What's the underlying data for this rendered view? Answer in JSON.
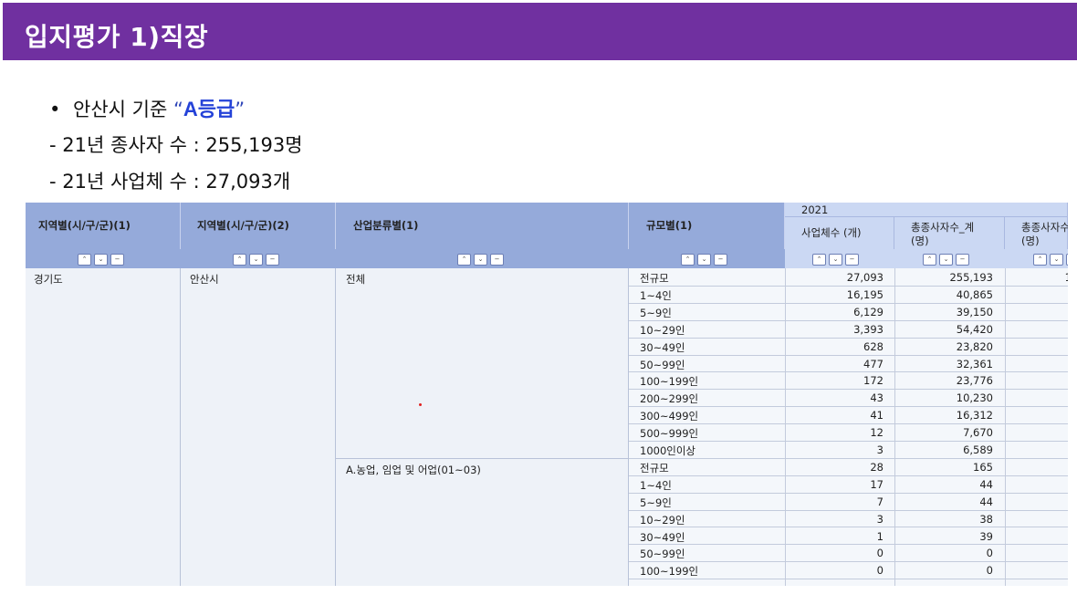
{
  "title": "입지평가 1)직장",
  "bullet": {
    "prefix": "안산시 기준 ",
    "quote_open": "“",
    "grade": "A등급",
    "quote_close": "”"
  },
  "stats": [
    "- 21년 종사자 수 : 255,193명",
    "- 21년 사업체 수 : 27,093개"
  ],
  "table": {
    "year": "2021",
    "headers": {
      "region1": "지역별(시/구/군)(1)",
      "region2": "지역별(시/구/군)(2)",
      "industry": "산업분류별(1)",
      "scale": "규모별(1)",
      "col_a": "사업체수 (개)",
      "col_b_1": "총종사자수_계",
      "col_b_2": "(명)",
      "col_c_1": "총종사자수",
      "col_c_2": "(명)"
    },
    "ctrl": {
      "up": "⌃",
      "down": "⌄",
      "minus": "−"
    },
    "region1": "경기도",
    "region2": "안산시",
    "industry_groups": [
      {
        "name": "전체",
        "rows": [
          {
            "scale": "전규모",
            "a": "27,093",
            "b": "255,193",
            "c": "1"
          },
          {
            "scale": "1~4인",
            "a": "16,195",
            "b": "40,865",
            "c": ""
          },
          {
            "scale": "5~9인",
            "a": "6,129",
            "b": "39,150",
            "c": ""
          },
          {
            "scale": "10~29인",
            "a": "3,393",
            "b": "54,420",
            "c": ""
          },
          {
            "scale": "30~49인",
            "a": "628",
            "b": "23,820",
            "c": ""
          },
          {
            "scale": "50~99인",
            "a": "477",
            "b": "32,361",
            "c": ""
          },
          {
            "scale": "100~199인",
            "a": "172",
            "b": "23,776",
            "c": ""
          },
          {
            "scale": "200~299인",
            "a": "43",
            "b": "10,230",
            "c": ""
          },
          {
            "scale": "300~499인",
            "a": "41",
            "b": "16,312",
            "c": ""
          },
          {
            "scale": "500~999인",
            "a": "12",
            "b": "7,670",
            "c": ""
          },
          {
            "scale": "1000인이상",
            "a": "3",
            "b": "6,589",
            "c": ""
          }
        ]
      },
      {
        "name": "A.농업, 임업 및 어업(01~03)",
        "rows": [
          {
            "scale": "전규모",
            "a": "28",
            "b": "165",
            "c": ""
          },
          {
            "scale": "1~4인",
            "a": "17",
            "b": "44",
            "c": ""
          },
          {
            "scale": "5~9인",
            "a": "7",
            "b": "44",
            "c": ""
          },
          {
            "scale": "10~29인",
            "a": "3",
            "b": "38",
            "c": ""
          },
          {
            "scale": "30~49인",
            "a": "1",
            "b": "39",
            "c": ""
          },
          {
            "scale": "50~99인",
            "a": "0",
            "b": "0",
            "c": ""
          },
          {
            "scale": "100~199인",
            "a": "0",
            "b": "0",
            "c": ""
          }
        ]
      }
    ]
  }
}
